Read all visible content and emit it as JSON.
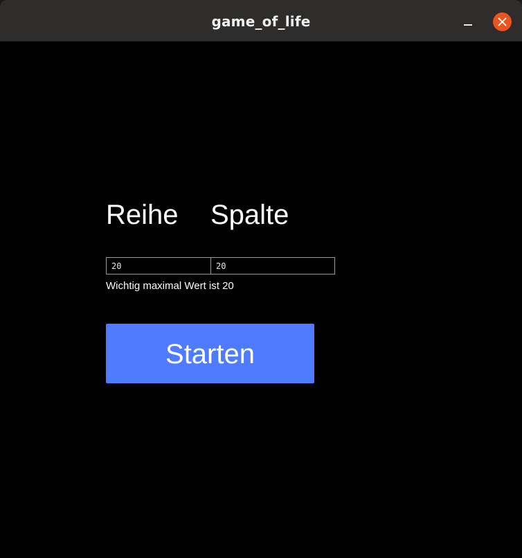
{
  "window": {
    "title": "game_of_life"
  },
  "titlebar": {
    "minimize_icon": "minimize-icon",
    "close_icon": "close-icon",
    "close_color": "#e95420"
  },
  "form": {
    "row_label": "Reihe",
    "column_label": "Spalte",
    "row_value": "20",
    "column_value": "20",
    "hint": "Wichtig maximal Wert ist 20",
    "start_label": "Starten"
  },
  "colors": {
    "accent": "#4f7cff",
    "background": "#000000"
  }
}
